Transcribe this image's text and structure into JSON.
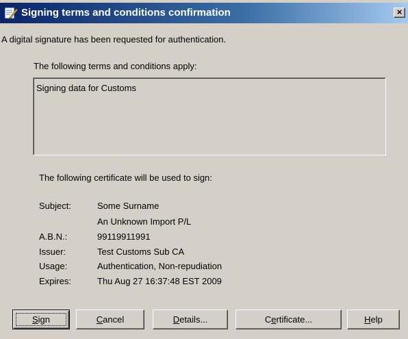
{
  "window": {
    "title": "Signing terms and conditions confirmation",
    "close_label": "×"
  },
  "intro": "A digital signature has been requested for authentication.",
  "terms": {
    "heading": "The following terms and conditions apply:",
    "text": "Signing data for Customs"
  },
  "certificate": {
    "heading": "The following certificate will be used to sign:",
    "fields": [
      {
        "label": "Subject:",
        "value": "Some Surname"
      },
      {
        "label": "",
        "value": "An Unknown Import P/L"
      },
      {
        "label": "A.B.N.:",
        "value": "99119911991"
      },
      {
        "label": "Issuer:",
        "value": "Test Customs Sub CA"
      },
      {
        "label": "Usage:",
        "value": "Authentication, Non-repudiation"
      },
      {
        "label": "Expires:",
        "value": "Thu Aug 27 16:37:48 EST 2009"
      }
    ]
  },
  "buttons": {
    "sign": {
      "pre": "",
      "mn": "S",
      "post": "ign"
    },
    "cancel": {
      "pre": "",
      "mn": "C",
      "post": "ancel"
    },
    "details": {
      "pre": "",
      "mn": "D",
      "post": "etails..."
    },
    "certificate": {
      "pre": "C",
      "mn": "e",
      "post": "rtificate..."
    },
    "help": {
      "pre": "",
      "mn": "H",
      "post": "elp"
    }
  },
  "icons": {
    "title_icon": "signature-pen-icon",
    "close_icon": "close-icon"
  }
}
